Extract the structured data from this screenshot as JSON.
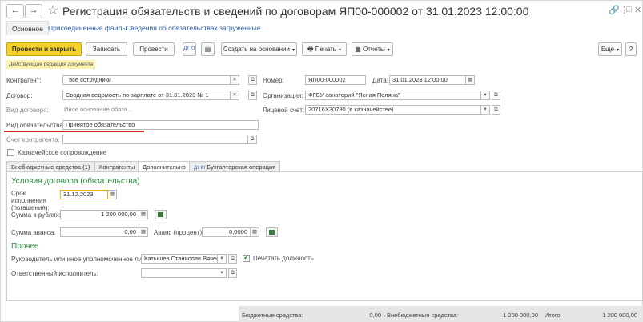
{
  "window": {
    "title": "Регистрация обязательств и сведений по договорам ЯП00-000002 от 31.01.2023 12:00:00",
    "back_icon": "arrow-left",
    "forward_icon": "arrow-right",
    "link_icon": "🔗",
    "more_icon": "⋮",
    "max_icon": "□",
    "close_icon": "✕"
  },
  "section_tabs": [
    {
      "label": "Основное"
    },
    {
      "label": "Присоединенные файлы"
    },
    {
      "label": "Сведения об обязательствах загруженные"
    }
  ],
  "toolbar": {
    "post_close": "Провести и закрыть",
    "save": "Записать",
    "post": "Провести",
    "dt_kt": "Дт Кт",
    "create_basis": "Создать на основании",
    "print": "Печать",
    "reports": "Отчеты",
    "more": "Еще",
    "help": "?"
  },
  "banner": "Действующая редакция документа",
  "form": {
    "contractor_label": "Контрагент:",
    "contractor": "_все сотрудники",
    "number_label": "Номер:",
    "number": "ЯП00-000002",
    "date_label": "Дата:",
    "date": "31.01.2023 12:00:00",
    "contract_label": "Договор:",
    "contract": "Сводная ведомость по зарплате от 31.01.2023 № 1",
    "org_label": "Организация:",
    "org": "ФГБУ санаторий \"Ясная Поляна\"",
    "contract_type_label": "Вид договора:",
    "contract_type": "Иное основание обяза...",
    "account_label": "Лицевой счет:",
    "account": "20716Х30730 (в казначействе)",
    "obligation_type_label": "Вид обязательства:",
    "obligation_type": "Принятое обязательство",
    "contractor_account_label": "Счет контрагента:",
    "contractor_account": "",
    "treasury_label": "Казначейское сопровождение"
  },
  "inner_tabs": [
    {
      "label": "Внебюджетные средства (1)"
    },
    {
      "label": "Контрагенты"
    },
    {
      "label": "Дополнительно"
    },
    {
      "label": "Бухгалтерская операция"
    }
  ],
  "additional": {
    "section1": "Условия договора (обязательства)",
    "due_label": "Срок исполнения (погашения):",
    "due": "31.12.2023",
    "sum_rub_label": "Сумма в рублях:",
    "sum_rub": "1 200 000,00",
    "advance_label": "Сумма аванса:",
    "advance": "0,00",
    "advance_pct_label": "Аванс (процент):",
    "advance_pct": "0,0000",
    "section2": "Прочее",
    "head_label": "Руководитель или иное уполномоченное лицо:",
    "head": "Катышев Станислав Вячес",
    "print_position_label": "Печатать должность",
    "print_position_checked": true,
    "executor_label": "Ответственный исполнитель:",
    "executor": ""
  },
  "footer": {
    "budget_label": "Бюджетные средства:",
    "budget": "0,00",
    "extra_label": "Внебюджетные средства:",
    "extra": "1 200 000,00",
    "total_label": "Итого:",
    "total": "1 200 000,00"
  },
  "colors": {
    "accent": "#f5d12b",
    "link": "#2c5aa0",
    "section": "#2e8b3a",
    "highlight": "#d4222a"
  }
}
